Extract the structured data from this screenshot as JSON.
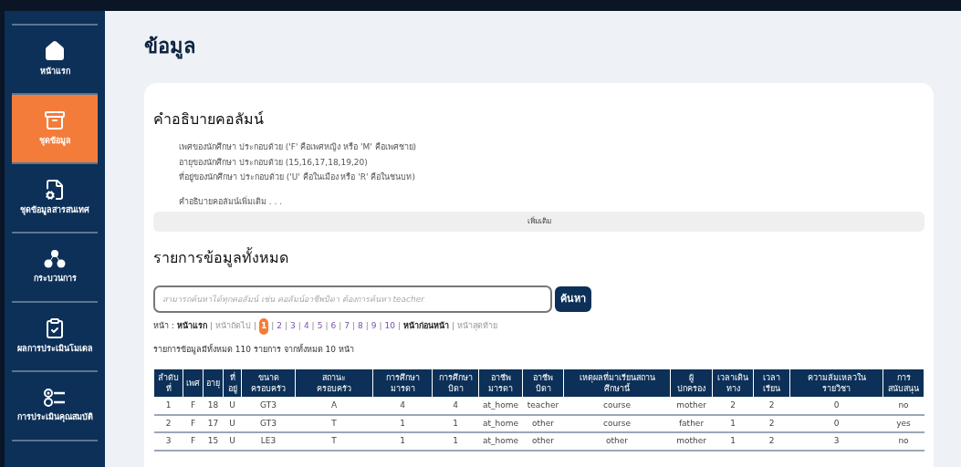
{
  "sidebar": {
    "items": [
      {
        "label": "หน้าแรก",
        "selected": false
      },
      {
        "label": "ชุดข้อมูล",
        "selected": true
      },
      {
        "label": "ชุดข้อมูลสารสนเทศ",
        "selected": false
      },
      {
        "label": "กระบวนการ",
        "selected": false
      },
      {
        "label": "ผลการประเมินโมเดล",
        "selected": false
      },
      {
        "label": "การประเมินคุณสมบัติ",
        "selected": false
      }
    ]
  },
  "page_title": "ข้อมูล",
  "column_description": {
    "title": "คำอธิบายคอลัมน์",
    "lines": [
      "เพศของนักศึกษา ประกอบด้วย ('F' คือเพศหญิง หรือ 'M' คือเพศชาย)",
      "อายุของนักศึกษา ประกอบด้วย (15,16,17,18,19,20)",
      "ที่อยู่ของนักศึกษา ประกอบด้วย ('U' คือในเมือง หรือ 'R' คือในชนบท)"
    ],
    "more_text": "คำอธิบายคอลัมน์เพิ่มเติม . . .",
    "more_button": "เพิ่มเติม"
  },
  "records": {
    "title": "รายการข้อมูลทั้งหมด",
    "search": {
      "placeholder": "สามารถค้นหาได้ทุกคอลัมน์ เช่น คอลัมน์อาชีพบิดา ต้องการค้นหา teacher",
      "button": "ค้นหา"
    },
    "pagination": {
      "label": "หน้า :",
      "separator": "|",
      "items": [
        {
          "text": "หน้าแรก",
          "kind": "nav",
          "disabled": false,
          "selected": false
        },
        {
          "text": "หน้าถัดไป",
          "kind": "nav",
          "disabled": true,
          "selected": false
        },
        {
          "text": "1",
          "kind": "page",
          "selected": true
        },
        {
          "text": "2",
          "kind": "page",
          "selected": false
        },
        {
          "text": "3",
          "kind": "page",
          "selected": false
        },
        {
          "text": "4",
          "kind": "page",
          "selected": false
        },
        {
          "text": "5",
          "kind": "page",
          "selected": false
        },
        {
          "text": "6",
          "kind": "page",
          "selected": false
        },
        {
          "text": "7",
          "kind": "page",
          "selected": false
        },
        {
          "text": "8",
          "kind": "page",
          "selected": false
        },
        {
          "text": "9",
          "kind": "page",
          "selected": false
        },
        {
          "text": "10",
          "kind": "page",
          "selected": false
        },
        {
          "text": "หน้าก่อนหน้า",
          "kind": "nav",
          "disabled": false,
          "selected": false
        },
        {
          "text": "หน้าสุดท้าย",
          "kind": "nav",
          "disabled": true,
          "selected": false
        }
      ]
    },
    "summary": "รายการข้อมูลมีทั้งหมด 110 รายการ จากทั้งหมด 10 หน้า",
    "table": {
      "columns": [
        "ลำดับ\nที่",
        "เพศ",
        "อายุ",
        "ที่\nอยู่",
        "ขนาด\nครอบครัว",
        "สถานะ\nครอบครัว",
        "การศึกษา\nมารดา",
        "การศึกษา\nบิดา",
        "อาชีพ\nมารดา",
        "อาชีพ\nบิดา",
        "เหตุผลที่มาเรียนสถาน\nศึกษานี้",
        "ผู้\nปกครอง",
        "เวลาเดิน\nทาง",
        "เวลา\nเรียน",
        "ความล้มเหลวใน\nรายวิชา",
        "การ\nสนับสนุน"
      ],
      "rows": [
        [
          "1",
          "F",
          "18",
          "U",
          "GT3",
          "A",
          "4",
          "4",
          "at_home",
          "teacher",
          "course",
          "mother",
          "2",
          "2",
          "0",
          "no"
        ],
        [
          "2",
          "F",
          "17",
          "U",
          "GT3",
          "T",
          "1",
          "1",
          "at_home",
          "other",
          "course",
          "father",
          "1",
          "2",
          "0",
          "yes"
        ],
        [
          "3",
          "F",
          "15",
          "U",
          "LE3",
          "T",
          "1",
          "1",
          "at_home",
          "other",
          "other",
          "mother",
          "1",
          "2",
          "3",
          "no"
        ]
      ]
    }
  }
}
